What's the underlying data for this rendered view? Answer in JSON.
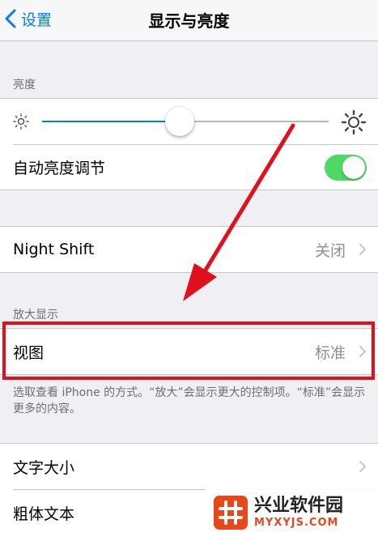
{
  "nav": {
    "back_label": "设置",
    "title": "显示与亮度"
  },
  "brightness": {
    "section_header": "亮度",
    "slider_level_percent": 48,
    "auto_label": "自动亮度调节",
    "auto_enabled": true,
    "icons": [
      "sun-small-icon",
      "sun-large-icon"
    ]
  },
  "night_shift": {
    "label": "Night Shift",
    "value": "关闭"
  },
  "zoom": {
    "section_header": "放大显示",
    "label": "视图",
    "value": "标准",
    "footer": "选取查看 iPhone 的方式。“放大”会显示更大的控制项。“标准”会显示更多的内容。"
  },
  "text": {
    "size_label": "文字大小",
    "bold_label": "粗体文本"
  },
  "watermark": {
    "title": "兴业软件园",
    "domain": "MYXYJS.COM"
  },
  "colors": {
    "accent": "#007aff",
    "toggle_on": "#4cd964",
    "annotation": "#e0101c",
    "background": "#efeff4"
  }
}
